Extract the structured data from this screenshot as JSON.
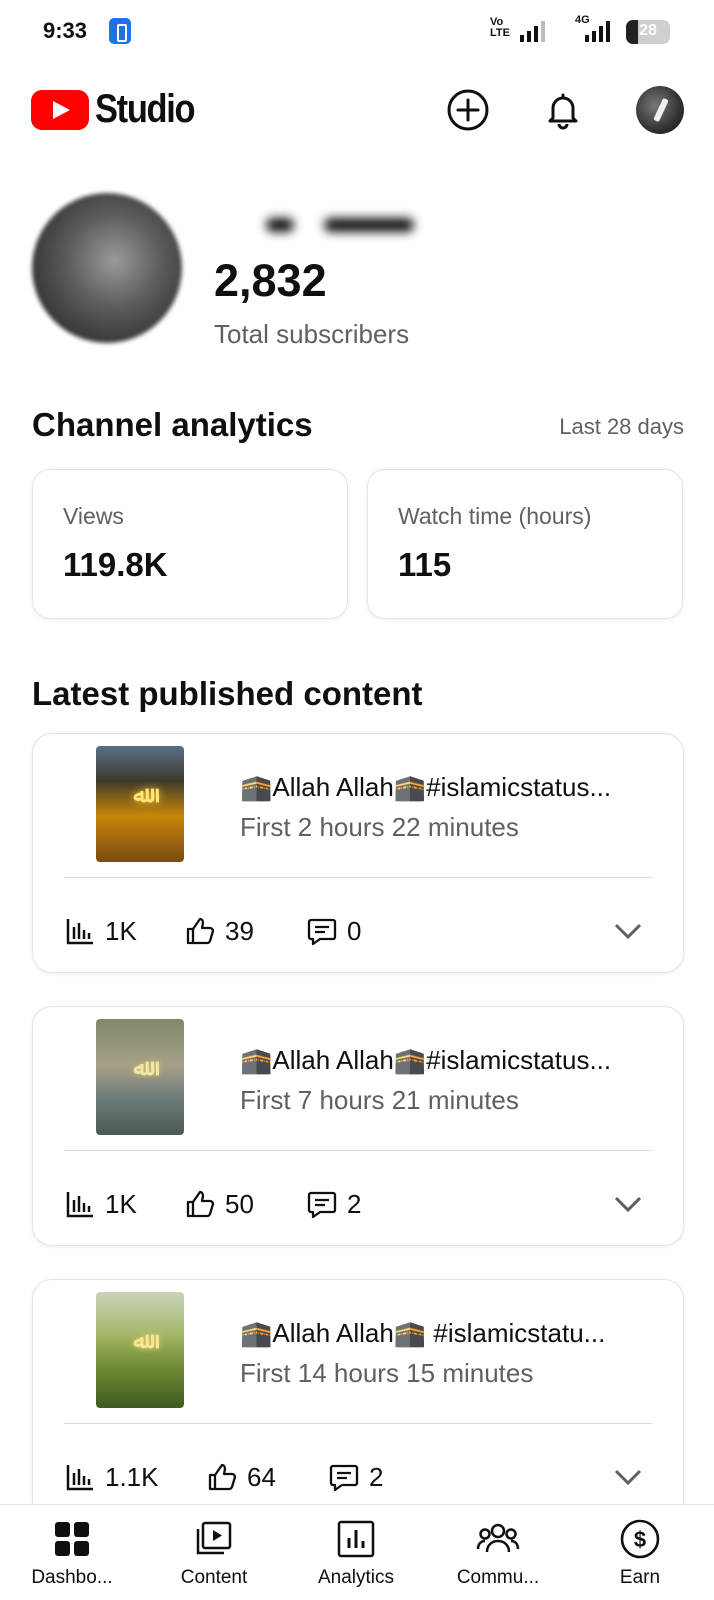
{
  "status_bar": {
    "time": "9:33",
    "network": "Vo LTE",
    "network_gen": "4G",
    "battery": "28",
    "battery_level_percent": 28
  },
  "header": {
    "app_name": "Studio",
    "icons": [
      "create-icon",
      "notifications-icon",
      "account-avatar"
    ]
  },
  "channel": {
    "subscribers": "2,832",
    "subscribers_label": "Total subscribers"
  },
  "analytics": {
    "title": "Channel analytics",
    "range": "Last 28 days",
    "cards": [
      {
        "label": "Views",
        "value": "119.8K"
      },
      {
        "label": "Watch time (hours)",
        "value": "115"
      }
    ]
  },
  "latest": {
    "title": "Latest published content",
    "items": [
      {
        "title": "🕋Allah Allah🕋#islamicstatus...",
        "subtitle": "First 2 hours 22 minutes",
        "views": "1K",
        "likes": "39",
        "comments": "0"
      },
      {
        "title": "🕋Allah Allah🕋#islamicstatus...",
        "subtitle": "First 7 hours 21 minutes",
        "views": "1K",
        "likes": "50",
        "comments": "2"
      },
      {
        "title": "🕋Allah Allah🕋 #islamicstatu...",
        "subtitle": "First 14 hours 15 minutes",
        "views": "1.1K",
        "likes": "64",
        "comments": "2"
      }
    ]
  },
  "bottom_nav": {
    "items": [
      {
        "label": "Dashbo...",
        "icon": "dashboard-icon"
      },
      {
        "label": "Content",
        "icon": "content-icon"
      },
      {
        "label": "Analytics",
        "icon": "analytics-icon"
      },
      {
        "label": "Commu...",
        "icon": "community-icon"
      },
      {
        "label": "Earn",
        "icon": "earn-icon"
      }
    ]
  },
  "colors": {
    "brand_red": "#ff0000",
    "text_primary": "#0f0f0f",
    "text_secondary": "#606060"
  }
}
